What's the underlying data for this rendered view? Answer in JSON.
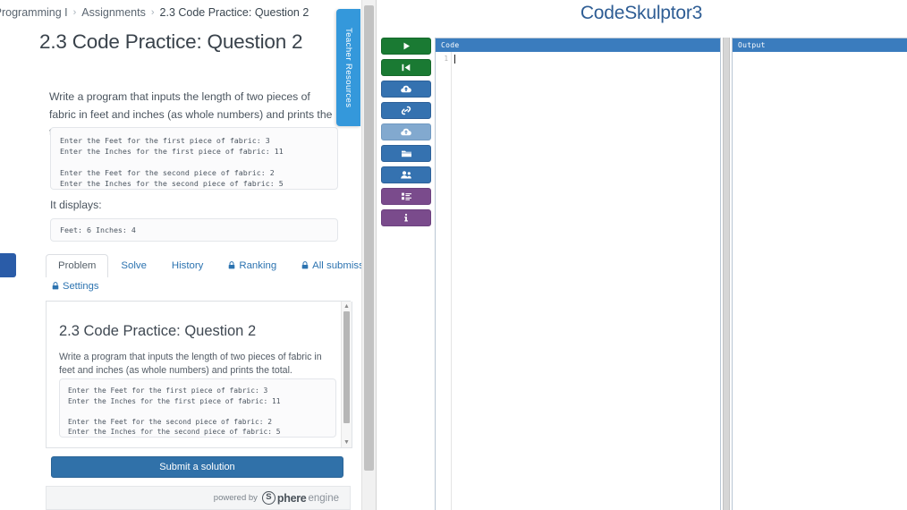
{
  "breadcrumb": {
    "items": [
      "r Programming I",
      "Assignments",
      "2.3 Code Practice: Question 2"
    ],
    "separator": "›"
  },
  "page": {
    "title": "2.3 Code Practice: Question 2",
    "prompt": "Write a program that inputs the length of two pieces of fabric in feet and inches (as whole numbers) and prints the total.",
    "sample_io": "Enter the Feet for the first piece of fabric: 3\nEnter the Inches for the first piece of fabric: 11\n\nEnter the Feet for the second piece of fabric: 2\nEnter the Inches for the second piece of fabric: 5",
    "it_displays_label": "It displays:",
    "display_output": "Feet: 6 Inches: 4"
  },
  "teacher_tab": {
    "label": "Teacher Resources"
  },
  "widget": {
    "tabs": [
      {
        "label": "Problem",
        "locked": false,
        "active": true
      },
      {
        "label": "Solve",
        "locked": false,
        "active": false
      },
      {
        "label": "History",
        "locked": false,
        "active": false
      },
      {
        "label": "Ranking",
        "locked": true,
        "active": false
      },
      {
        "label": "All submissions",
        "locked": true,
        "active": false
      }
    ],
    "help_label": "?",
    "settings_label": "Settings",
    "settings_locked": true,
    "lock_glyph": "🔒",
    "problem": {
      "title": "2.3 Code Practice: Question 2",
      "text": "Write a program that inputs the length of two pieces of fabric in feet and inches (as whole numbers) and prints the total.",
      "sample_io": "Enter the Feet for the first piece of fabric: 3\nEnter the Inches for the first piece of fabric: 11\n\nEnter the Feet for the second piece of fabric: 2\nEnter the Inches for the second piece of fabric: 5"
    },
    "submit_label": "Submit a solution",
    "footer": {
      "powered_by": "powered by",
      "brand_initial": "S",
      "brand_word": "phere",
      "brand_suffix": "engine"
    }
  },
  "codeskulptor": {
    "title": "CodeSkulptor3",
    "toolbar": [
      {
        "name": "run-button",
        "icon": "play-icon",
        "color": "#1a7a33"
      },
      {
        "name": "reset-button",
        "icon": "skip-back-icon",
        "color": "#1a7a33"
      },
      {
        "name": "save-button",
        "icon": "cloud-upload-icon",
        "color": "#3572b0"
      },
      {
        "name": "sync-button",
        "icon": "link-icon",
        "color": "#3572b0"
      },
      {
        "name": "upload-button",
        "icon": "cloud-upload-icon",
        "color": "#82a9cf"
      },
      {
        "name": "open-button",
        "icon": "folder-icon",
        "color": "#3572b0"
      },
      {
        "name": "users-button",
        "icon": "users-icon",
        "color": "#3572b0"
      },
      {
        "name": "demos-button",
        "icon": "list-icon",
        "color": "#7a4b8c"
      },
      {
        "name": "info-button",
        "icon": "info-icon",
        "color": "#7a4b8c"
      }
    ],
    "code_panel_title": "Code",
    "output_panel_title": "Output",
    "code_line_number": "1",
    "code_content": "",
    "output_content": ""
  },
  "colors": {
    "accent_blue": "#3071a9",
    "header_blue": "#3a7cbe",
    "teacher_blue": "#3498db",
    "green": "#1a7a33",
    "purple": "#7a4b8c"
  }
}
